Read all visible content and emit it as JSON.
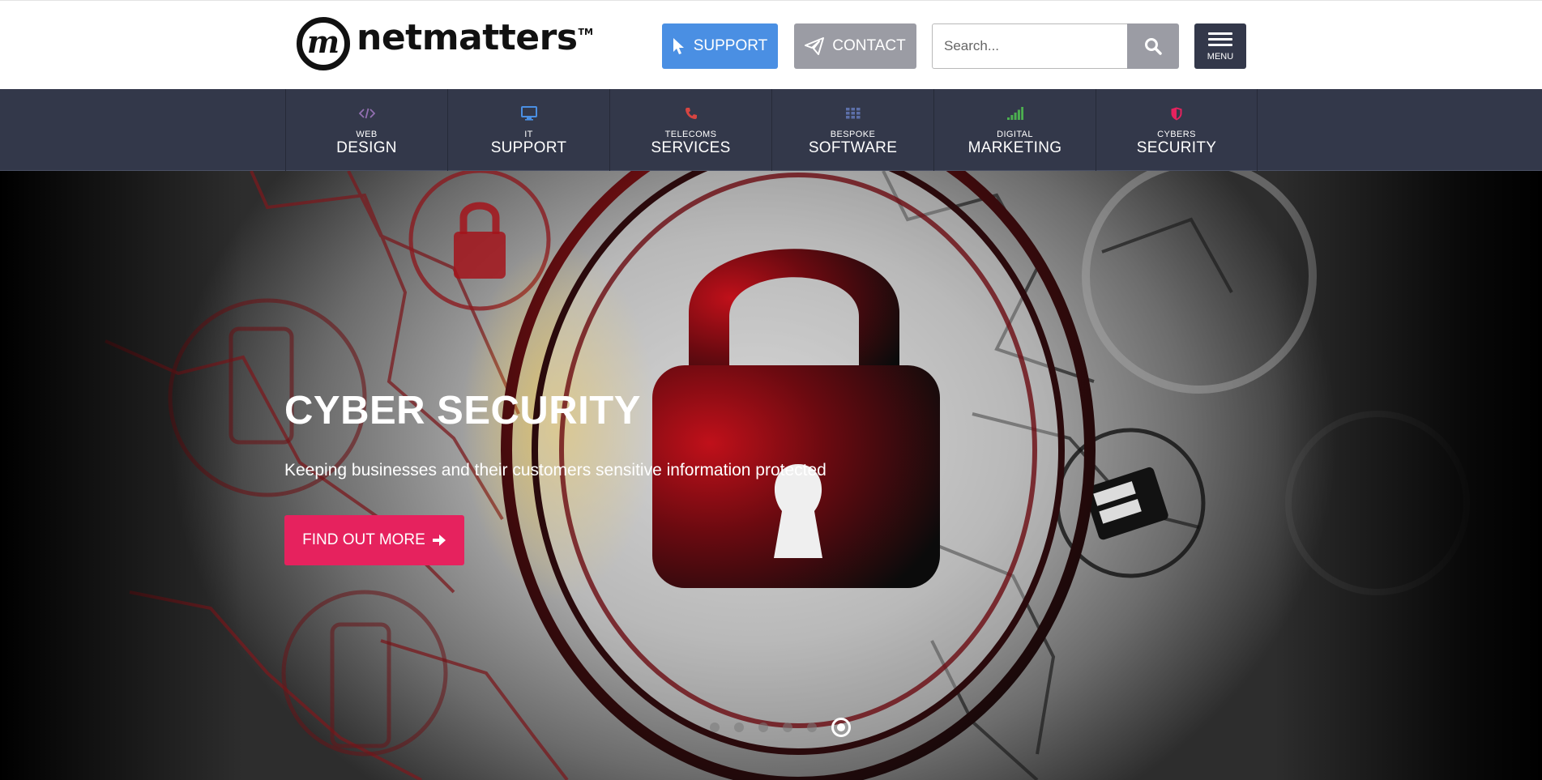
{
  "header": {
    "logo_text": "netmatters",
    "logo_mark": "m",
    "logo_tm": "TM",
    "support_label": "SUPPORT",
    "contact_label": "CONTACT",
    "search_placeholder": "Search...",
    "menu_label": "MENU"
  },
  "services": [
    {
      "small": "WEB",
      "big": "DESIGN",
      "icon": "code-icon",
      "color": "#926fb1"
    },
    {
      "small": "IT",
      "big": "SUPPORT",
      "icon": "monitor-icon",
      "color": "#4a8fe3"
    },
    {
      "small": "TELECOMS",
      "big": "SERVICES",
      "icon": "phone-icon",
      "color": "#d64541"
    },
    {
      "small": "BESPOKE",
      "big": "SOFTWARE",
      "icon": "grid-icon",
      "color": "#5c6fa8"
    },
    {
      "small": "DIGITAL",
      "big": "MARKETING",
      "icon": "signal-bars-icon",
      "color": "#4caf50"
    },
    {
      "small": "CYBERS",
      "big": "SECURITY",
      "icon": "shield-icon",
      "color": "#e6225e"
    }
  ],
  "hero": {
    "title": "CYBER SECURITY",
    "subtitle": "Keeping businesses and their customers sensitive information protected",
    "cta_label": "FIND OUT MORE",
    "slide_count": 6,
    "active_slide": 6
  },
  "colors": {
    "support_blue": "#4a8fe3",
    "contact_grey": "#9b9ca4",
    "nav_dark": "#33384a",
    "cta_pink": "#e6225e"
  }
}
